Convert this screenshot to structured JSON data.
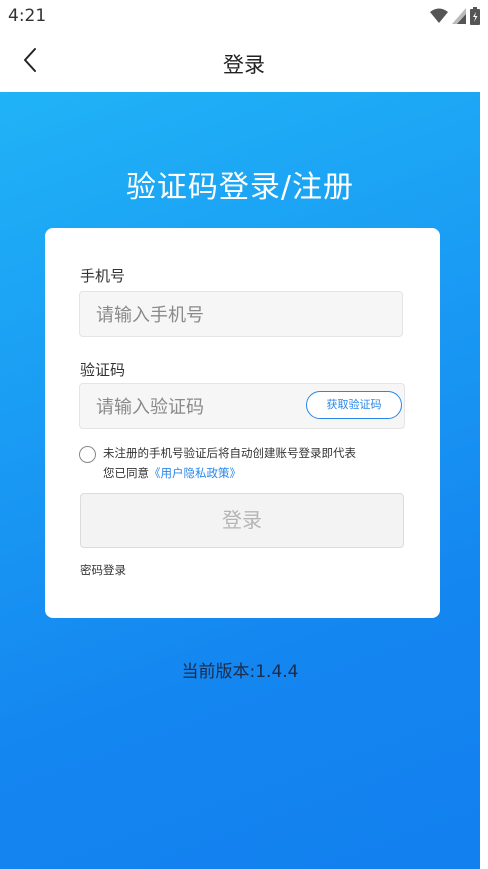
{
  "status_bar": {
    "time": "4:21",
    "icons": [
      "wifi-icon",
      "signal-icon",
      "battery-icon"
    ]
  },
  "top_bar": {
    "back_icon": "chevron-left-icon",
    "title": "登录"
  },
  "hero": {
    "heading": "验证码登录/注册"
  },
  "form": {
    "phone_label": "手机号",
    "phone_placeholder": "请输入手机号",
    "code_label": "验证码",
    "code_placeholder": "请输入验证码",
    "get_code_button": "获取验证码",
    "agree_text_line1": "未注册的手机号验证后将自动创建账号登录即代表",
    "agree_text_line2": "您已同意",
    "privacy_policy_link": "《用户隐私政策》",
    "login_button": "登录",
    "password_login_link": "密码登录"
  },
  "footer": {
    "version": "当前版本:1.4.4"
  },
  "colors": {
    "accent": "#2a86e8",
    "gradient_top": "#20b3f6",
    "gradient_bottom": "#1280ef"
  }
}
